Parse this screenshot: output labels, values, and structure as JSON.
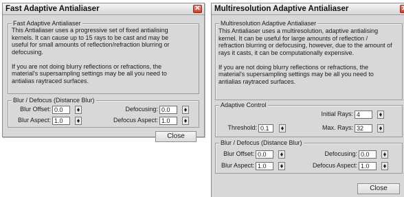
{
  "dialog_fast": {
    "title": "Fast Adaptive Antialiaser",
    "group_title": "Fast Adaptive Antialiaser",
    "description": [
      "This Antialiaser uses a progressive set of fixed antialising",
      "kernels.  It can cause up to 15 rays to be cast and may be",
      "useful for small amounts of reflection/refraction blurring or",
      "defocusing.",
      "",
      "If you are not doing blurry reflections or refractions, the",
      "material's supersampling settings may be all you need to",
      "antialias raytraced surfaces."
    ],
    "blur_group_title": "Blur / Defocus (Distance Blur)",
    "blur_offset_label": "Blur Offset:",
    "blur_offset_value": "0.0",
    "defocusing_label": "Defocusing:",
    "defocusing_value": "0.0",
    "blur_aspect_label": "Blur Aspect:",
    "blur_aspect_value": "1.0",
    "defocus_aspect_label": "Defocus Aspect:",
    "defocus_aspect_value": "1.0",
    "close_label": "Close",
    "close_icon": "close-x-icon"
  },
  "dialog_multi": {
    "title": "Multiresolution Adaptive Antialiaser",
    "group_title": "Multiresolution Adaptive Antialiaser",
    "description": [
      "This Antialiaser uses a multiresolution, adaptive antialising",
      "kernel.  It can be useful for large amounts of reflection /",
      "refraction blurring or defocusing, however, due to the amount of",
      "rays it casts, it can be computationally expensive.",
      "",
      "If you are not doing blurry reflections or refractions, the",
      "material's supersampling settings may be all you need to",
      "antialias raytraced surfaces."
    ],
    "adaptive_group_title": "Adaptive Control",
    "initial_rays_label": "Initial Rays:",
    "initial_rays_value": "4",
    "threshold_label": "Threshold:",
    "threshold_value": "0.1",
    "max_rays_label": "Max. Rays:",
    "max_rays_value": "32",
    "blur_group_title": "Blur / Defocus (Distance Blur)",
    "blur_offset_label": "Blur Offset:",
    "blur_offset_value": "0.0",
    "defocusing_label": "Defocusing:",
    "defocusing_value": "0.0",
    "blur_aspect_label": "Blur Aspect:",
    "blur_aspect_value": "1.0",
    "defocus_aspect_label": "Defocus Aspect:",
    "defocus_aspect_value": "1.0",
    "close_label": "Close",
    "close_icon": "close-x-icon"
  }
}
